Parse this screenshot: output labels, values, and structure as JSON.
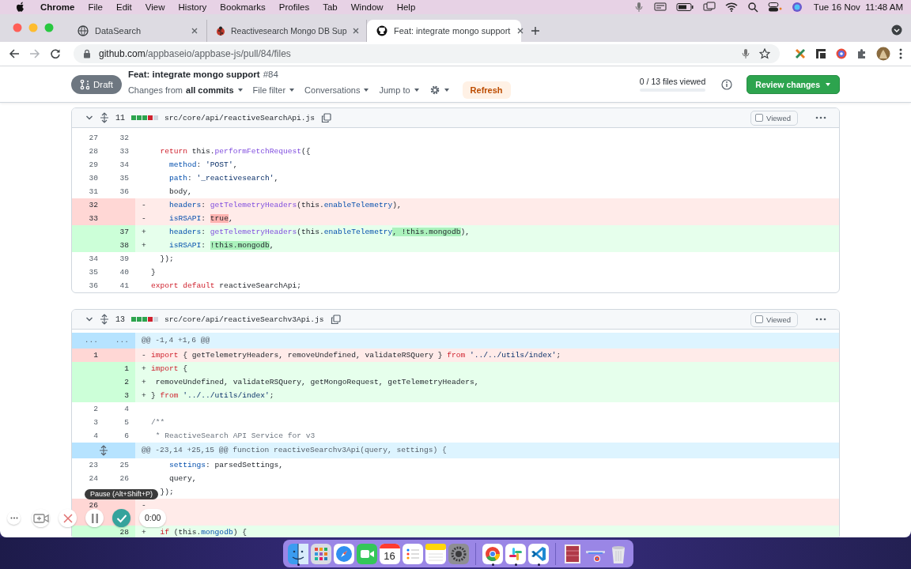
{
  "menu_bar": {
    "app": "Chrome",
    "items": [
      "File",
      "Edit",
      "View",
      "History",
      "Bookmarks",
      "Profiles",
      "Tab",
      "Window",
      "Help"
    ],
    "clock": "Tue 16 Nov  11:48 AM"
  },
  "tabs": [
    {
      "kind": "globe",
      "title": "DataSearch",
      "selected": false
    },
    {
      "kind": "bug",
      "title": "Reactivesearch Mongo DB Sup",
      "selected": false
    },
    {
      "kind": "github",
      "title": "Feat: integrate mongo support",
      "selected": true
    }
  ],
  "address": {
    "host": "github.com",
    "path": "/appbaseio/appbase-js/pull/84/files"
  },
  "pr": {
    "state": "Draft",
    "title": "Feat: integrate mongo support",
    "number": "#84",
    "changes_label": "Changes from",
    "changes_value": "all commits",
    "menus": [
      "File filter",
      "Conversations",
      "Jump to"
    ],
    "refresh": "Refresh",
    "files_viewed": "0 / 13 files viewed",
    "progress": {
      "level": 0
    },
    "review": "Review changes"
  },
  "files": [
    {
      "expanded": true,
      "changes": "11",
      "diffstat": [
        {
          "kind": "add"
        },
        {
          "kind": "add"
        },
        {
          "kind": "add"
        },
        {
          "kind": "del"
        },
        {
          "kind": "none"
        }
      ],
      "path": "src/core/api/reactiveSearchApi.js",
      "viewed": false,
      "viewed_label": "Viewed",
      "rows": [
        {
          "kind": "ctx",
          "old": "27",
          "new": "32"
        },
        {
          "kind": "ctx",
          "old": "28",
          "new": "33",
          "code": [
            {
              "text": "  return",
              "kind": "kw"
            },
            {
              "text": " this."
            },
            {
              "text": "performFetchRequest",
              "kind": "fn"
            },
            {
              "text": "({"
            }
          ]
        },
        {
          "kind": "ctx",
          "old": "29",
          "new": "34",
          "code": [
            {
              "text": "    method",
              "kind": "prop"
            },
            {
              "text": ": "
            },
            {
              "text": "'POST'",
              "kind": "str"
            },
            {
              "text": ","
            }
          ]
        },
        {
          "kind": "ctx",
          "old": "30",
          "new": "35",
          "code": [
            {
              "text": "    path",
              "kind": "prop"
            },
            {
              "text": ": "
            },
            {
              "text": "'_reactivesearch'",
              "kind": "str"
            },
            {
              "text": ","
            }
          ]
        },
        {
          "kind": "ctx",
          "old": "31",
          "new": "36",
          "code": [
            {
              "text": "    body,"
            }
          ]
        },
        {
          "kind": "del",
          "old": "32",
          "sign": "-",
          "code": [
            {
              "text": "    headers",
              "kind": "prop"
            },
            {
              "text": ": "
            },
            {
              "text": "getTelemetryHeaders",
              "kind": "fn"
            },
            {
              "text": "(this."
            },
            {
              "text": "enableTelemetry",
              "kind": "prop"
            },
            {
              "text": "),"
            }
          ]
        },
        {
          "kind": "del",
          "old": "33",
          "sign": "-",
          "code": [
            {
              "text": "    isRSAPI",
              "kind": "prop"
            },
            {
              "text": ": "
            },
            {
              "text": "true",
              "hl": true
            },
            {
              "text": ","
            }
          ]
        },
        {
          "kind": "add",
          "new": "37",
          "sign": "+",
          "code": [
            {
              "text": "    headers",
              "kind": "prop"
            },
            {
              "text": ": "
            },
            {
              "text": "getTelemetryHeaders",
              "kind": "fn"
            },
            {
              "text": "(this."
            },
            {
              "text": "enableTelemetry",
              "kind": "prop"
            },
            {
              "text": ", !this.mongodb",
              "hl": true
            },
            {
              "text": "),"
            }
          ]
        },
        {
          "kind": "add",
          "new": "38",
          "sign": "+",
          "code": [
            {
              "text": "    isRSAPI",
              "kind": "prop"
            },
            {
              "text": ": "
            },
            {
              "text": "!this.mongodb",
              "hl": true
            },
            {
              "text": ","
            }
          ]
        },
        {
          "kind": "ctx",
          "old": "34",
          "new": "39",
          "code": [
            {
              "text": "  });"
            }
          ]
        },
        {
          "kind": "ctx",
          "old": "35",
          "new": "40",
          "code": [
            {
              "text": "}"
            }
          ]
        },
        {
          "kind": "ctx",
          "old": "36",
          "new": "41",
          "code": [
            {
              "text": "export",
              "kind": "kw"
            },
            {
              "text": " default",
              "kind": "kw"
            },
            {
              "text": " reactiveSearchApi;"
            }
          ]
        }
      ]
    },
    {
      "expanded": true,
      "changes": "13",
      "diffstat": [
        {
          "kind": "add"
        },
        {
          "kind": "add"
        },
        {
          "kind": "add"
        },
        {
          "kind": "del"
        },
        {
          "kind": "none"
        }
      ],
      "path": "src/core/api/reactiveSearchv3Api.js",
      "viewed": false,
      "viewed_label": "Viewed",
      "rows": [
        {
          "kind": "hunk",
          "old": "...",
          "new": "...",
          "code": [
            {
              "text": "@@ -1,4 +1,6 @@",
              "kind": "hunk"
            }
          ]
        },
        {
          "kind": "del",
          "old": "1",
          "sign": "-",
          "code": [
            {
              "text": "import",
              "kind": "kw"
            },
            {
              "text": " { getTelemetryHeaders, removeUndefined, validateRSQuery } "
            },
            {
              "text": "from",
              "kind": "kw"
            },
            {
              "text": " '../../utils/index'",
              "kind": "str"
            },
            {
              "text": ";"
            }
          ]
        },
        {
          "kind": "add",
          "new": "1",
          "sign": "+",
          "code": [
            {
              "text": "import",
              "kind": "kw"
            },
            {
              "text": " {"
            }
          ]
        },
        {
          "kind": "add",
          "new": "2",
          "sign": "+",
          "code": [
            {
              "text": " removeUndefined, validateRSQuery, getMongoRequest, getTelemetryHeaders,"
            }
          ]
        },
        {
          "kind": "add",
          "new": "3",
          "sign": "+",
          "code": [
            {
              "text": "} "
            },
            {
              "text": "from",
              "kind": "kw"
            },
            {
              "text": " '../../utils/index'",
              "kind": "str"
            },
            {
              "text": ";"
            }
          ]
        },
        {
          "kind": "ctx",
          "old": "2",
          "new": "4"
        },
        {
          "kind": "ctx",
          "old": "3",
          "new": "5",
          "code": [
            {
              "text": "/**",
              "kind": "cm"
            }
          ]
        },
        {
          "kind": "ctx",
          "old": "4",
          "new": "6",
          "code": [
            {
              "text": " * ReactiveSearch API Service for v3",
              "kind": "cm"
            }
          ]
        },
        {
          "kind": "hunk",
          "expander": true,
          "code": [
            {
              "text": "@@ -23,14 +25,15 @@ function reactiveSearchv3Api(query, settings) {",
              "kind": "hunk"
            }
          ]
        },
        {
          "kind": "ctx",
          "old": "23",
          "new": "25",
          "code": [
            {
              "text": "    settings",
              "kind": "prop"
            },
            {
              "text": ": parsedSettings,"
            }
          ]
        },
        {
          "kind": "ctx",
          "old": "24",
          "new": "26",
          "code": [
            {
              "text": "    query,"
            }
          ]
        },
        {
          "kind": "ctx",
          "code": [
            {
              "text": "  });"
            }
          ]
        },
        {
          "kind": "del",
          "old": "26",
          "sign": "-"
        },
        {
          "kind": "del"
        },
        {
          "kind": "add",
          "new": "28",
          "sign": "+",
          "code": [
            {
              "text": "  if",
              "kind": "kw"
            },
            {
              "text": " (this."
            },
            {
              "text": "mongodb",
              "kind": "prop"
            },
            {
              "text": ") {"
            }
          ]
        }
      ]
    }
  ],
  "recorder": {
    "tooltip": "Pause (Alt+Shift+P)",
    "timer": "0:00"
  },
  "dock": [
    {
      "items": [
        {
          "kind": "finder",
          "running": true
        },
        {
          "kind": "launchpad",
          "running": false
        },
        {
          "kind": "safari",
          "running": false
        },
        {
          "kind": "facetime",
          "running": false
        },
        {
          "kind": "calendar",
          "day": "16",
          "running": false
        },
        {
          "kind": "reminders",
          "running": false
        },
        {
          "kind": "notes",
          "running": false
        },
        {
          "kind": "settings",
          "running": false
        }
      ]
    },
    {
      "items": [
        {
          "kind": "chrome",
          "running": true
        },
        {
          "kind": "slack",
          "running": true
        },
        {
          "kind": "vscode",
          "running": true
        }
      ]
    },
    {
      "items": [
        {
          "kind": "thumbnail",
          "running": false
        },
        {
          "kind": "stack",
          "running": false
        },
        {
          "kind": "trash",
          "running": false
        }
      ]
    }
  ]
}
